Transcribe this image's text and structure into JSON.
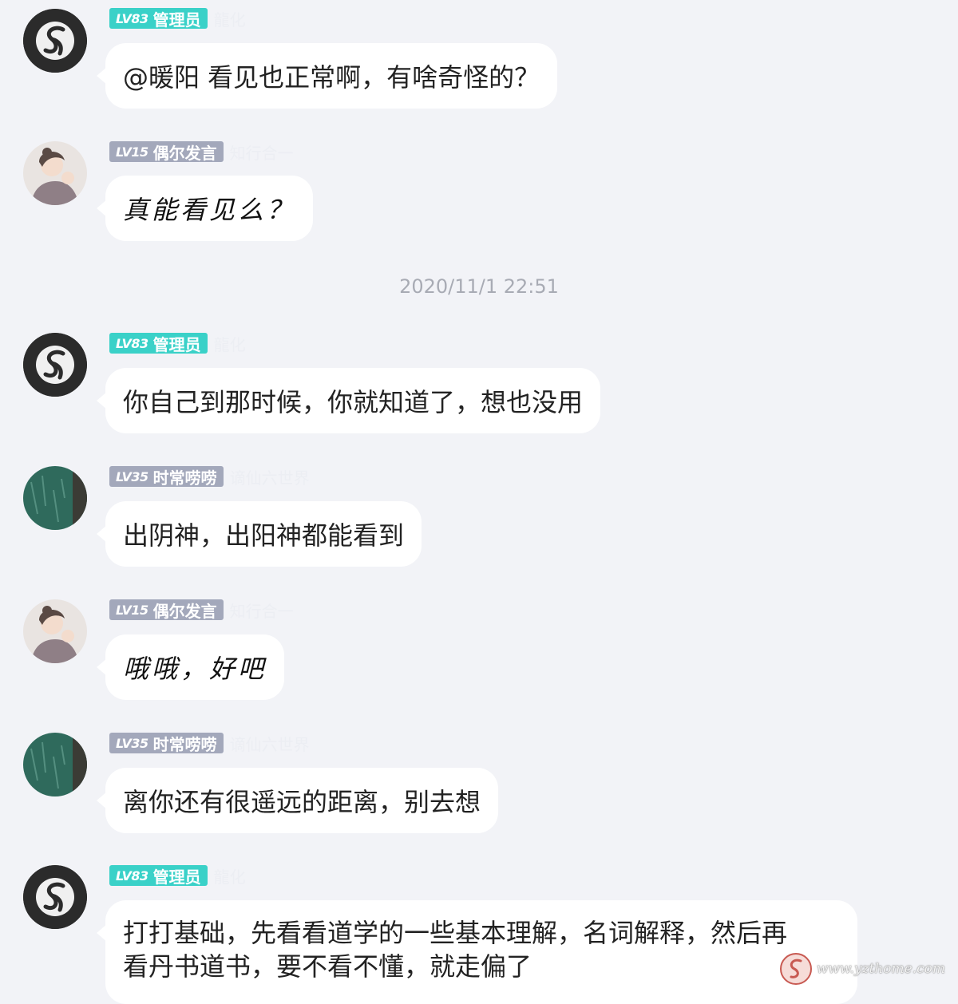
{
  "colors": {
    "background": "#f2f3f7",
    "bubble": "#ffffff",
    "admin_badge": "#3ad1c8",
    "member_badge": "#a3a8bb",
    "timestamp": "#a8abb4"
  },
  "timestamp": "2020/11/1 22:51",
  "messages": [
    {
      "avatar": "admin-avatar",
      "level": "LV83",
      "title": "管理员",
      "nickname": "龍化",
      "text": "@暖阳 看见也正常啊，有啥奇怪的？"
    },
    {
      "avatar": "girl-avatar",
      "level": "LV15",
      "title": "偶尔发言",
      "nickname": "知行合一",
      "text": "真能看见么？"
    },
    {
      "avatar": "admin-avatar",
      "level": "LV83",
      "title": "管理员",
      "nickname": "龍化",
      "text": "你自己到那时候，你就知道了，想也没用"
    },
    {
      "avatar": "chalkboard-avatar",
      "level": "LV35",
      "title": "时常唠唠",
      "nickname": "谪仙六世界",
      "text": "出阴神，出阳神都能看到"
    },
    {
      "avatar": "girl-avatar",
      "level": "LV15",
      "title": "偶尔发言",
      "nickname": "知行合一",
      "text": "哦哦，好吧"
    },
    {
      "avatar": "chalkboard-avatar",
      "level": "LV35",
      "title": "时常唠唠",
      "nickname": "谪仙六世界",
      "text": "离你还有很遥远的距离，别去想"
    },
    {
      "avatar": "admin-avatar",
      "level": "LV83",
      "title": "管理员",
      "nickname": "龍化",
      "text_line1": "打打基础，先看看道学的一些基本理解，名词解释，然后再",
      "text_line2": "看丹书道书，要不看不懂，就走偏了"
    }
  ],
  "watermark": {
    "text": "www.yzthome.com",
    "icon": "spiral-logo-icon"
  }
}
